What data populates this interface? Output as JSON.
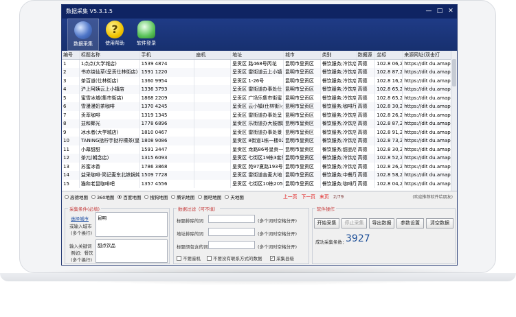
{
  "window": {
    "title": "数据采集 V5.3.1.5"
  },
  "toolbar": {
    "items": [
      {
        "label": "数据采集"
      },
      {
        "label": "使用帮助"
      },
      {
        "label": "软件登录"
      }
    ]
  },
  "table": {
    "headers": [
      "编号",
      "标题名称",
      "手机",
      "座机",
      "地址",
      "城市",
      "类别",
      "数据源",
      "坐标",
      "来源网址(双击打"
    ],
    "rows": [
      [
        "1",
        "1点点(大学城店)",
        "1539 4874",
        "",
        "呈贡区 路468号丙花",
        "昆明市呈贡区",
        "餐饮服务;冷饮店",
        "高德",
        "102.8 06,24",
        "https://dit du.amap.c"
      ],
      [
        "2",
        "书亦烧仙草(呈贡仕林街店)",
        "1591 1220",
        "",
        "呈贡区 雷街道云上小镇",
        "昆明市呈贡区",
        "餐饮服务;冷饮店",
        "高德",
        "102.8 87,24",
        "https://dit du.amap.c"
      ],
      [
        "3",
        "茶百道(仕林街店)",
        "1360 9954",
        "",
        "呈贡区 1-26号",
        "昆明市呈贡区",
        "餐饮服务;冷饮店",
        "高德",
        "102.8 16,24",
        "https://dit du.amap.c"
      ],
      [
        "4",
        "沪上阿姨云上小镇店",
        "1336 3793",
        "",
        "呈贡区 雷街道办事处仕",
        "昆明市呈贡区",
        "餐饮服务;冷饮店",
        "高德",
        "102.8 65,24",
        "https://dit du.amap.c"
      ],
      [
        "5",
        "蜜雪冰城(集市街店)",
        "1868 2209",
        "",
        "呈贡区 广场乐集市街蜜",
        "昆明市呈贡区",
        "餐饮服务;冷饮店",
        "高德",
        "102.8 65,24",
        "https://dit du.amap.c"
      ],
      [
        "6",
        "雪漫漫奶茶咖啡",
        "1370 4245",
        "",
        "呈贡区 云小镇(仕林街)小",
        "昆明市呈贡区",
        "餐饮服务;咖啡厅;",
        "高德",
        "102.8 30,24",
        "https://dit du.amap.c"
      ],
      [
        "7",
        "贡萃咖啡",
        "1319 1345",
        "",
        "呈贡区 雷街道办事处呈",
        "昆明市呈贡区",
        "餐饮服务;冷饮店",
        "高德",
        "102.8 26,24",
        "https://dit du.amap.c"
      ],
      [
        "8",
        "益和椰光",
        "1778 6896",
        "",
        "呈贡区 乐街道办大鼓御路",
        "昆明市呈贡区",
        "餐饮服务;冷饮店",
        "高德",
        "102.8 87,24",
        "https://dit du.amap.c"
      ],
      [
        "9",
        "冰水者(大学城店)",
        "1810 0467",
        "",
        "呈贡区 雷街道办事处景",
        "昆明市呈贡区",
        "餐饮服务;冷饮店",
        "高德",
        "102.8 91,24",
        "https://dit du.amap.c"
      ],
      [
        "10",
        "TANING挞柠手挞柠檬茶(呈贡大",
        "1808 9086",
        "",
        "呈贡区 8街道1栋一楼02号",
        "昆明市呈贡区",
        "餐饮服务;冷饮店",
        "高德",
        "102.8 73,24",
        "https://dit du.amap.c"
      ],
      [
        "11",
        "小幕甜甜",
        "1591 3447",
        "",
        "呈贡区 龙路86号呈贡一中",
        "昆明市呈贡区",
        "餐饮服务;甜品店;",
        "高德",
        "102.8 30,24",
        "https://dit du.amap.c"
      ],
      [
        "12",
        "茶兀(朝念店)",
        "1315 6093",
        "",
        "呈贡区 七街区19栋3套外",
        "昆明市呈贡区",
        "餐饮服务;冷饮店",
        "高德",
        "102.8 52,24",
        "https://dit du.amap.c"
      ],
      [
        "13",
        "苏蜜冰香",
        "1786 3868",
        "",
        "呈贡区 苑97夏路193号",
        "昆明市呈贡区",
        "餐饮服务;冷饮店",
        "高德",
        "102.8 26,24",
        "https://dit du.amap.c"
      ],
      [
        "14",
        "益采咖啡·简记麦东北铁锅炖",
        "1509 7728",
        "",
        "呈贡区 雷街道吉麦大地",
        "昆明市呈贡区",
        "餐饮服务;中餐厅;",
        "高德",
        "102.8 58,24",
        "https://dit du.amap.c"
      ],
      [
        "15",
        "猫和老鼠咖啡吧",
        "1357 4556",
        "",
        "呈贡区 七街区10栋205铺",
        "昆明市呈贡区",
        "餐饮服务;咖啡厅;",
        "高德",
        "102.8 04,24",
        "https://dit du.amap.c"
      ]
    ]
  },
  "maps": {
    "options": [
      "高德地图",
      "360地图",
      "百度地图",
      "搜狗地图",
      "腾讯地图",
      "图吧地图",
      "天地图"
    ],
    "selected": "百度地图"
  },
  "pager": {
    "prev": "上一页",
    "next": "下一页",
    "last": "末页",
    "page": "2/79"
  },
  "tip": "(欢迎推荐软件给朋友)",
  "collect": {
    "label": "采集条件(必填)",
    "city_link": "选择城市",
    "city_or": "或输入城市",
    "city_hint": "(多个换行)",
    "city_value": "昆明",
    "kw_label": "输入关键词",
    "kw_example": "例如：餐饮",
    "kw_hint": "(多个换行)",
    "kw_value": "甜点饮品"
  },
  "filter": {
    "label": "数据过滤（可不填）",
    "title_exclude": "标题排除的词",
    "addr_exclude": "地址排除的词",
    "title_include": "标题须包含的词",
    "hint": "(多个词时空格分开)",
    "cb1": "不要座机",
    "cb2": "不要没有联系方式的数据",
    "cb3": "采集县级",
    "cb3_checked": "✓"
  },
  "ops": {
    "label": "软件操作",
    "start": "开始采集",
    "stop": "停止采集",
    "export": "导出数据",
    "settings": "参数设置",
    "clear": "清空数据",
    "count_label": "成功采集条数：",
    "count": "3927"
  },
  "colors": {
    "title_bg": "#0f2463",
    "accent_red": "#e01010",
    "count_blue": "#1c4e97"
  }
}
